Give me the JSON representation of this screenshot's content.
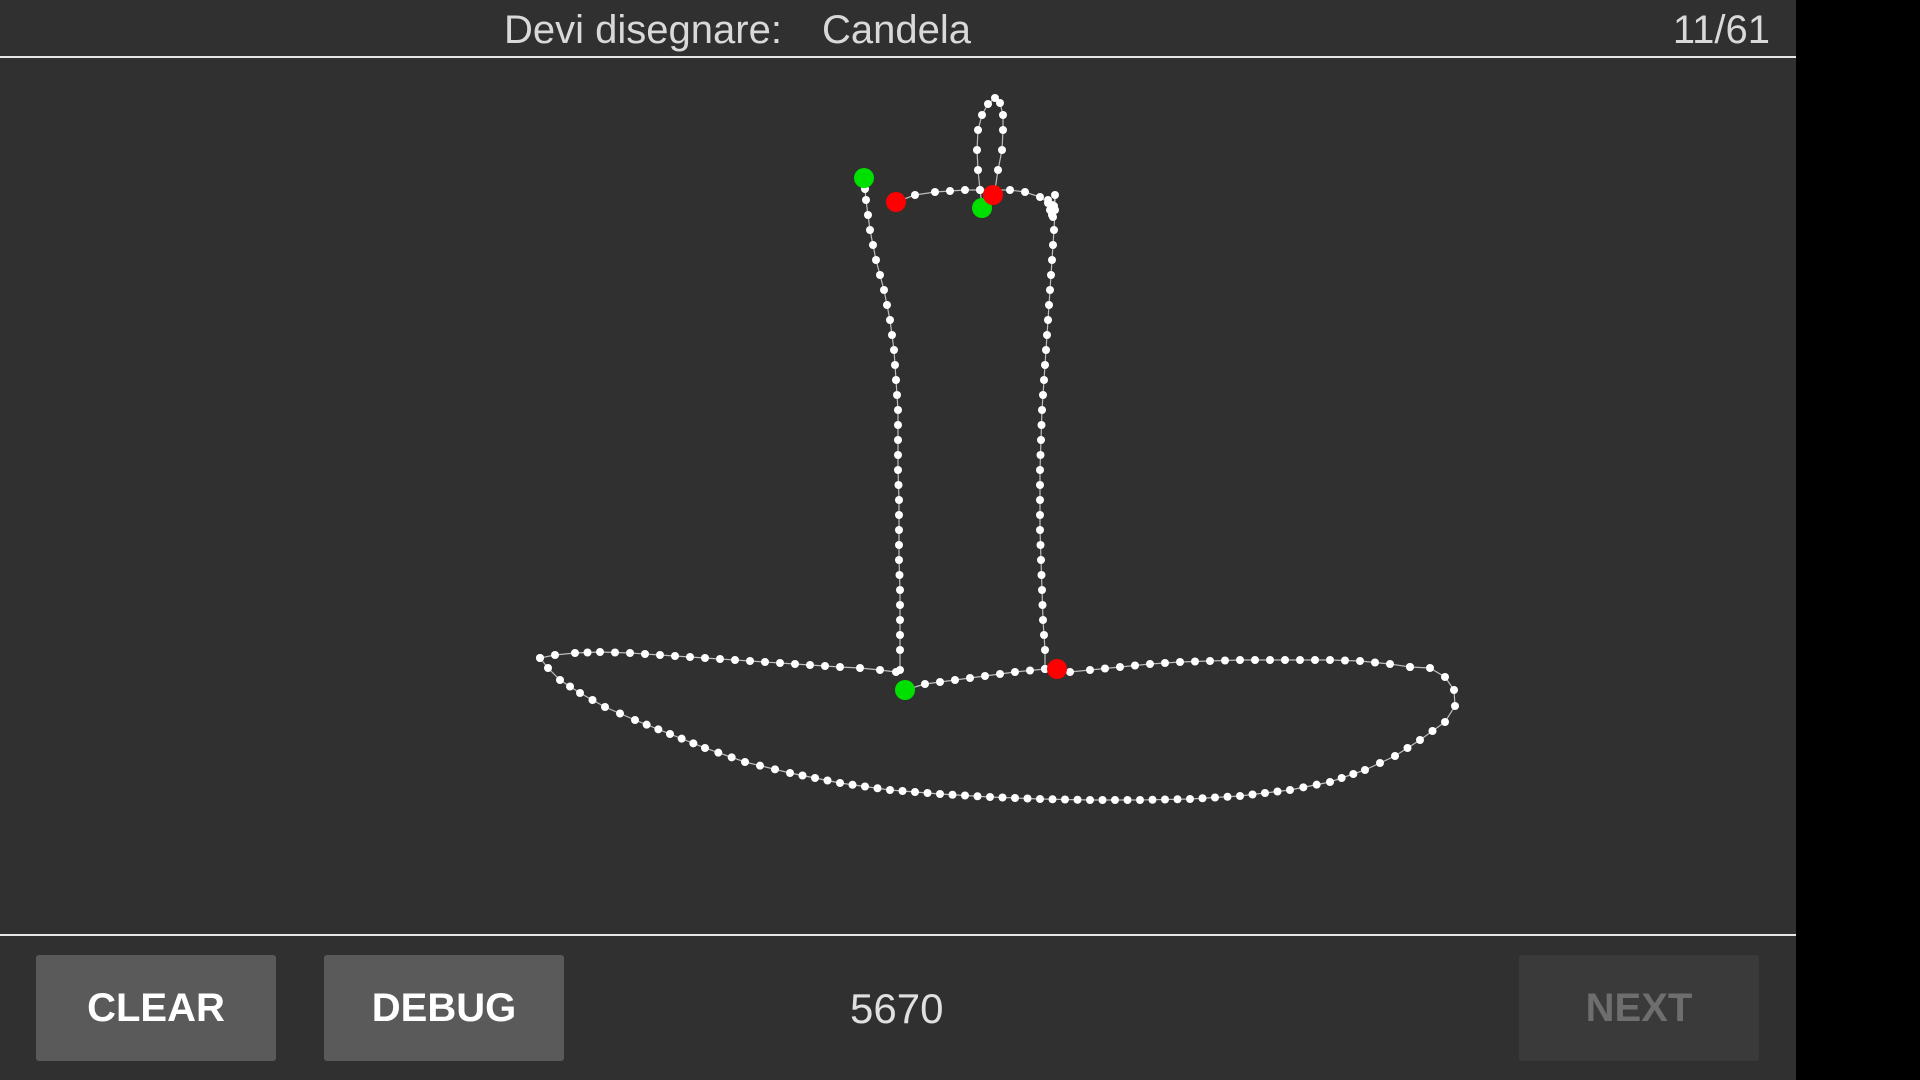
{
  "header": {
    "prompt_label": "Devi disegnare:",
    "prompt_word": "Candela",
    "progress": "11/61"
  },
  "footer": {
    "clear_label": "CLEAR",
    "debug_label": "DEBUG",
    "counter": "5670",
    "next_label": "NEXT"
  },
  "colors": {
    "background": "#303030",
    "stroke_point": "#ffffff",
    "stroke_start": "#00e000",
    "stroke_end": "#ff0000"
  }
}
